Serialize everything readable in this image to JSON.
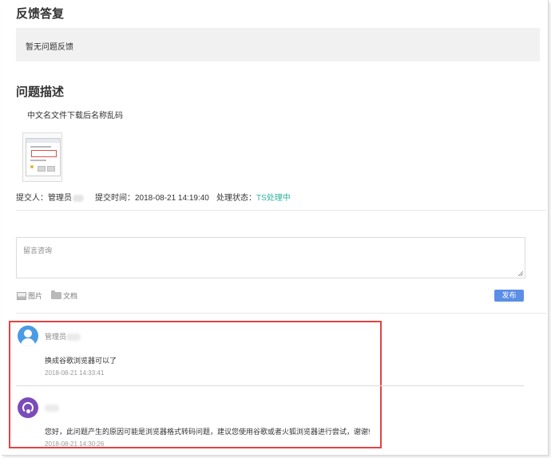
{
  "feedback": {
    "title": "反馈答复",
    "empty_text": "暂无问题反馈"
  },
  "description": {
    "title": "问题描述",
    "text": "中文名文件下载后名称乱码",
    "attachment_icon": "screenshot-thumbnail"
  },
  "meta": {
    "submitter_label": "提交人：",
    "submitter_name": "管理员",
    "submit_time_label": "提交时间：",
    "submit_time": "2018-08-21 14:19:40",
    "status_label": "处理状态：",
    "status_value": "TS处理中",
    "status_color": "#2bb39a"
  },
  "compose": {
    "placeholder": "留言咨询",
    "image_tool": "图片",
    "doc_tool": "文档",
    "publish_label": "发布"
  },
  "comments": [
    {
      "author": "管理员",
      "text": "换成谷歌浏览器可以了",
      "time": "2018-08-21 14:33:41",
      "avatar_color": "#4a9ae6"
    },
    {
      "author": "",
      "text": "您好，此问题产生的原因可能是浏览器格式转码问题，建议您使用谷歌或者火狐浏览器进行尝试，谢谢!",
      "time": "2018-08-21 14:30:26",
      "avatar_color": "#7b4bb9"
    }
  ],
  "colors": {
    "accent": "#5b8ee6",
    "highlight_border": "#e04444"
  }
}
